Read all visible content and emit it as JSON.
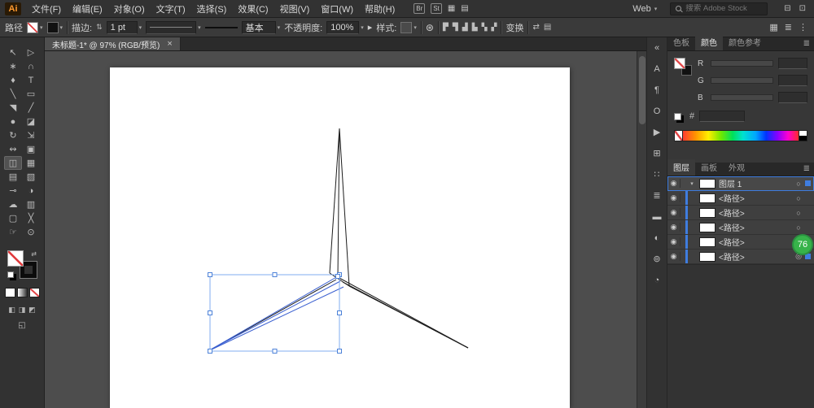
{
  "colors": {
    "accent_blue": "#3f7ddf",
    "selection_blue": "#82aef0",
    "path_blue": "#3a5fd0",
    "badge_green": "#37b34a",
    "none_slash_red": "#e0393b",
    "artboard_white": "#ffffff"
  },
  "menubar": {
    "logo": "Ai",
    "items": [
      "文件(F)",
      "编辑(E)",
      "对象(O)",
      "文字(T)",
      "选择(S)",
      "效果(C)",
      "视图(V)",
      "窗口(W)",
      "帮助(H)"
    ],
    "quick_icons": [
      {
        "name": "bridge-icon",
        "glyph": "Br",
        "cls": "boxed"
      },
      {
        "name": "stock-icon",
        "glyph": "St",
        "cls": "boxed"
      },
      {
        "name": "arrange-documents-icon",
        "glyph": "▦"
      },
      {
        "name": "document-layout-icon",
        "glyph": "▤"
      }
    ],
    "workspace": {
      "label": "Web",
      "chevron": "▾"
    },
    "search": {
      "placeholder": "搜索 Adobe Stock"
    },
    "window_icons": [
      {
        "name": "collapse-dock-icon",
        "glyph": "⊟"
      },
      {
        "name": "restore-window-icon",
        "glyph": "⊡"
      }
    ]
  },
  "controlbar": {
    "selection_type": "路径",
    "stroke_label": "描边:",
    "stroke_value": "1 pt",
    "stepper_glyph": "⇅",
    "brush_name": "基本",
    "opacity_label": "不透明度:",
    "opacity_value": "100%",
    "opacity_flyout": "▸",
    "style_label": "样式:",
    "recolor_glyph": "⊛",
    "transform_label": "变换",
    "align_icons": [
      {
        "name": "align-left-icon",
        "glyph": "▛"
      },
      {
        "name": "align-hcenter-icon",
        "glyph": "▜"
      },
      {
        "name": "align-right-icon",
        "glyph": "▟"
      },
      {
        "name": "align-top-icon",
        "glyph": "▙"
      },
      {
        "name": "align-vcenter-icon",
        "glyph": "▚"
      },
      {
        "name": "align-bottom-icon",
        "glyph": "▞"
      }
    ],
    "extra_icons": [
      {
        "name": "swap-icon",
        "glyph": "⇄"
      },
      {
        "name": "menu-icon",
        "glyph": "▤"
      }
    ],
    "right_icons": [
      {
        "name": "arrange-documents-icon",
        "glyph": "▦"
      },
      {
        "name": "panel-list-icon",
        "glyph": "≣"
      },
      {
        "name": "more-options-icon",
        "glyph": "⋮"
      }
    ]
  },
  "document_tab": {
    "title": "未标题-1* @ 97% (RGB/预览)",
    "close_label": "×"
  },
  "tools": [
    {
      "name": "selection-tool",
      "glyph": "↖"
    },
    {
      "name": "direct-selection-tool",
      "glyph": "▷"
    },
    {
      "name": "magic-wand-tool",
      "glyph": "∗"
    },
    {
      "name": "lasso-tool",
      "glyph": "∩"
    },
    {
      "name": "pen-tool",
      "glyph": "♦"
    },
    {
      "name": "type-tool",
      "glyph": "T"
    },
    {
      "name": "line-segment-tool",
      "glyph": "╲"
    },
    {
      "name": "rectangle-tool",
      "glyph": "▭"
    },
    {
      "name": "paintbrush-tool",
      "glyph": "◥"
    },
    {
      "name": "pencil-tool",
      "glyph": "╱"
    },
    {
      "name": "blob-brush-tool",
      "glyph": "●"
    },
    {
      "name": "eraser-tool",
      "glyph": "◪"
    },
    {
      "name": "rotate-tool",
      "glyph": "↻"
    },
    {
      "name": "scale-tool",
      "glyph": "⇲"
    },
    {
      "name": "width-tool",
      "glyph": "↭"
    },
    {
      "name": "free-transform-tool",
      "glyph": "▣"
    },
    {
      "name": "shape-builder-tool",
      "glyph": "◫",
      "cls": "active"
    },
    {
      "name": "perspective-grid-tool",
      "glyph": "▦"
    },
    {
      "name": "mesh-tool",
      "glyph": "▤"
    },
    {
      "name": "gradient-tool",
      "glyph": "▧"
    },
    {
      "name": "eyedropper-tool",
      "glyph": "⊸"
    },
    {
      "name": "blend-tool",
      "glyph": "◑"
    },
    {
      "name": "symbol-sprayer-tool",
      "glyph": "☁"
    },
    {
      "name": "column-graph-tool",
      "glyph": "▥"
    },
    {
      "name": "artboard-tool",
      "glyph": "▢"
    },
    {
      "name": "slice-tool",
      "glyph": "╳"
    },
    {
      "name": "hand-tool",
      "glyph": "☞"
    },
    {
      "name": "zoom-tool",
      "glyph": "⊙"
    }
  ],
  "toolbar_footer": {
    "swap_glyph": "⇄",
    "draw_mode_icons": [
      {
        "name": "draw-normal-icon",
        "glyph": "◧"
      },
      {
        "name": "draw-behind-icon",
        "glyph": "◨"
      },
      {
        "name": "draw-inside-icon",
        "glyph": "◩"
      }
    ],
    "screen_mode_glyph": "◱"
  },
  "dock_icons": [
    {
      "name": "expand-panels-icon",
      "glyph": "«"
    },
    {
      "name": "character-panel-icon",
      "glyph": "A"
    },
    {
      "name": "paragraph-panel-icon",
      "glyph": "¶"
    },
    {
      "name": "opentype-panel-icon",
      "glyph": "O"
    },
    {
      "name": "actions-panel-icon",
      "glyph": "▶"
    },
    {
      "name": "export-panel-icon",
      "glyph": "⊞"
    },
    {
      "name": "transform-panel-icon",
      "glyph": "∷"
    },
    {
      "name": "align-panel-icon",
      "glyph": "≣"
    },
    {
      "name": "stroke-panel-icon",
      "glyph": "▬"
    },
    {
      "name": "gradient-panel-icon",
      "glyph": "◐"
    },
    {
      "name": "symbols-panel-icon",
      "glyph": "⊚"
    },
    {
      "name": "appearance-panel-icon",
      "glyph": "◔"
    }
  ],
  "panels": {
    "color": {
      "tabs": [
        {
          "name": "tab-swatches",
          "label": "色板"
        },
        {
          "name": "tab-color",
          "label": "颜色",
          "cls": "active"
        },
        {
          "name": "tab-color-guide",
          "label": "颜色参考"
        }
      ],
      "menu_icon": "≣",
      "channels": [
        {
          "name": "channel-row-r",
          "label": "R"
        },
        {
          "name": "channel-row-g",
          "label": "G"
        },
        {
          "name": "channel-row-b",
          "label": "B"
        }
      ],
      "hex_label": "#"
    },
    "layers": {
      "tabs": [
        {
          "name": "tab-layers",
          "label": "图层",
          "cls": "active"
        },
        {
          "name": "tab-artboards",
          "label": "画板"
        },
        {
          "name": "tab-appearance",
          "label": "外观"
        }
      ],
      "menu_icon": "≣",
      "rows": [
        {
          "name": "layer-row",
          "label": "图层 1",
          "eye": "◉",
          "chev": "▾",
          "target": "○",
          "cls": "layer chip"
        },
        {
          "name": "path-row",
          "label": "<路径>",
          "eye": "◉",
          "chev": "",
          "target": "○",
          "cls": "path"
        },
        {
          "name": "path-row",
          "label": "<路径>",
          "eye": "◉",
          "chev": "",
          "target": "○",
          "cls": "path"
        },
        {
          "name": "path-row",
          "label": "<路径>",
          "eye": "◉",
          "chev": "",
          "target": "○",
          "cls": "path"
        },
        {
          "name": "path-row",
          "label": "<路径>",
          "eye": "◉",
          "chev": "",
          "target": "○",
          "cls": "path"
        },
        {
          "name": "path-row",
          "label": "<路径>",
          "eye": "◉",
          "chev": "",
          "target": "◎",
          "cls": "path chip"
        }
      ]
    }
  },
  "badge": {
    "value": "76"
  }
}
